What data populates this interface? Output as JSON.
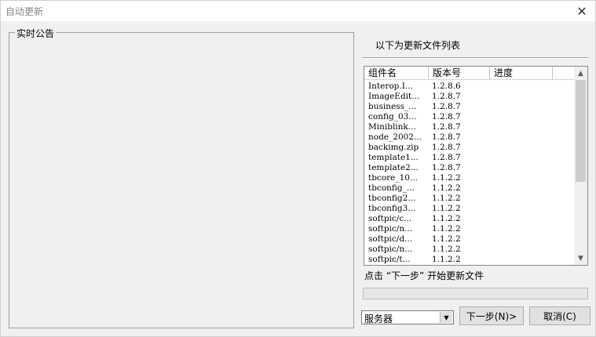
{
  "window": {
    "title": "自动更新",
    "close_glyph": "✕"
  },
  "notice": {
    "legend": "实时公告"
  },
  "file_list": {
    "label": "以下为更新文件列表",
    "columns": [
      "组件名",
      "版本号",
      "进度",
      ""
    ],
    "rows": [
      {
        "name": "Interop.I...",
        "version": "1.2.8.6",
        "progress": ""
      },
      {
        "name": "ImageEdit...",
        "version": "1.2.8.7",
        "progress": ""
      },
      {
        "name": "business_...",
        "version": "1.2.8.7",
        "progress": ""
      },
      {
        "name": "config_03...",
        "version": "1.2.8.7",
        "progress": ""
      },
      {
        "name": "Miniblink...",
        "version": "1.2.8.7",
        "progress": ""
      },
      {
        "name": "node_2002...",
        "version": "1.2.8.7",
        "progress": ""
      },
      {
        "name": "backimg.zip",
        "version": "1.2.8.7",
        "progress": ""
      },
      {
        "name": "template1...",
        "version": "1.2.8.7",
        "progress": ""
      },
      {
        "name": "template2...",
        "version": "1.2.8.7",
        "progress": ""
      },
      {
        "name": "tbcore_10...",
        "version": "1.1.2.2",
        "progress": ""
      },
      {
        "name": "tbconfig_...",
        "version": "1.1.2.2",
        "progress": ""
      },
      {
        "name": "tbconfig2...",
        "version": "1.1.2.2",
        "progress": ""
      },
      {
        "name": "tbconfig3...",
        "version": "1.1.2.2",
        "progress": ""
      },
      {
        "name": "softpic/c...",
        "version": "1.1.2.2",
        "progress": ""
      },
      {
        "name": "softpic/n...",
        "version": "1.1.2.2",
        "progress": ""
      },
      {
        "name": "softpic/d...",
        "version": "1.1.2.2",
        "progress": ""
      },
      {
        "name": "softpic/n...",
        "version": "1.1.2.2",
        "progress": ""
      },
      {
        "name": "softpic/t...",
        "version": "1.1.2.2",
        "progress": ""
      }
    ],
    "scroll_up_glyph": "▲",
    "scroll_down_glyph": "▼"
  },
  "hint": "点击 “下一步” 开始更新文件",
  "progress": {
    "value": 0
  },
  "server_select": {
    "value": "服务器",
    "arrow_glyph": "▼"
  },
  "buttons": {
    "next_label": "下一步(N)>",
    "cancel_label": "取消(C)"
  }
}
